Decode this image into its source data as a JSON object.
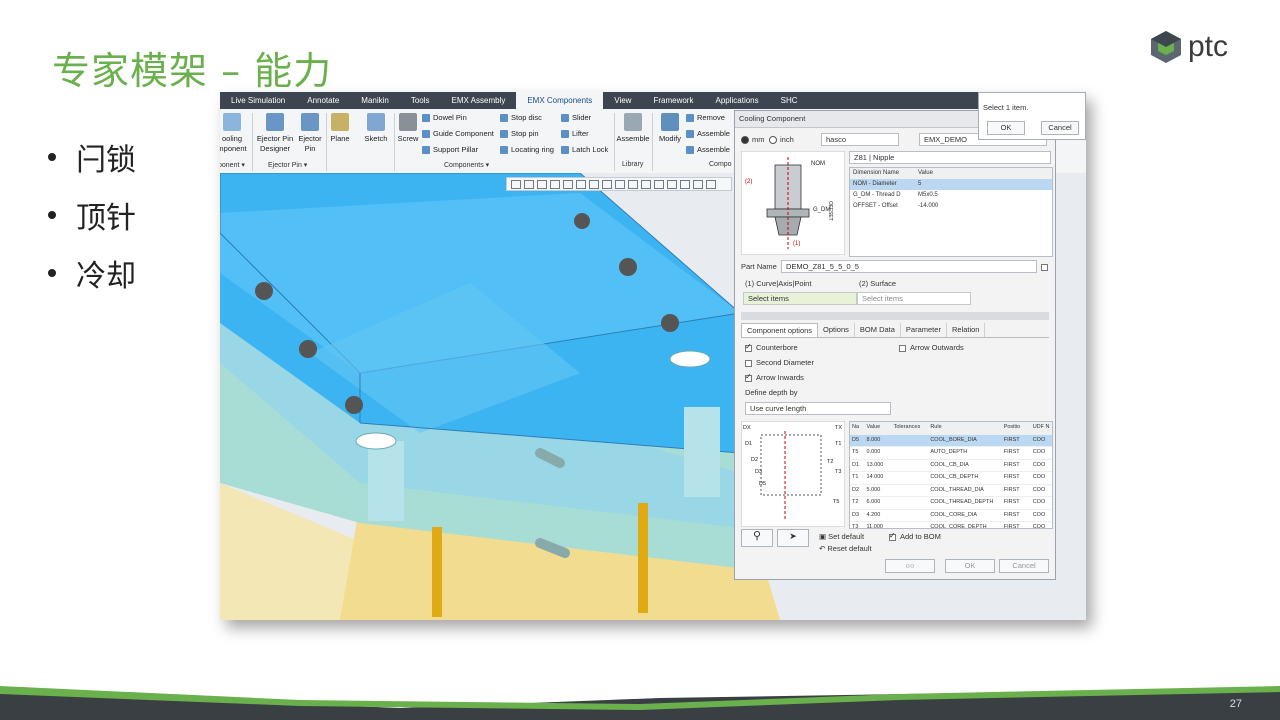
{
  "slide": {
    "title": "专家模架 – 能力",
    "bullets": [
      "闩锁",
      "顶针",
      "冷却"
    ],
    "page_number": "27",
    "logo_text": "ptc",
    "accent_color": "#6ab04c"
  },
  "app": {
    "tabs": [
      "Live Simulation",
      "Annotate",
      "Manikin",
      "Tools",
      "EMX Assembly",
      "EMX Components",
      "View",
      "Framework",
      "Applications",
      "SHC"
    ],
    "active_tab": "EMX Components",
    "ribbon": {
      "cooling_label_1": "ooling",
      "cooling_label_2": "mponent",
      "component_group_left": "ponent ▾",
      "ejector_pin_designer_1": "Ejector Pin",
      "ejector_pin_designer_2": "Designer",
      "ejector_pin_1": "Ejector",
      "ejector_pin_2": "Pin",
      "ejector_pin_group": "Ejector Pin ▾",
      "plane": "Plane",
      "sketch": "Sketch",
      "screw": "Screw",
      "dowel_pin": "Dowel Pin",
      "guide_component": "Guide Component",
      "support_pillar": "Support Pillar",
      "stop_disc": "Stop disc",
      "stop_pin": "Stop pin",
      "locating_ring": "Locating ring",
      "slider": "Slider",
      "lifter": "Lifter",
      "latch_lock": "Latch Lock",
      "components_group": "Components ▾",
      "assemble": "Assemble",
      "library_group": "Library",
      "modify": "Modify",
      "remove": "Remove",
      "assemble_2": "Assemble",
      "assemble_3": "Assemble",
      "compo_group": "Compo"
    },
    "popup": {
      "message": "Select 1 item.",
      "ok": "OK",
      "cancel": "Cancel"
    },
    "dialog": {
      "title": "Cooling Component",
      "unit_mm": "mm",
      "unit_inch": "inch",
      "unit_selected": "mm",
      "supplier": "hasco",
      "catalog": "EMX_DEMO",
      "component_type": "Z81 | Nipple",
      "dim_table": {
        "headers": [
          "Dimension Name",
          "Value"
        ],
        "rows": [
          [
            "NOM - Diameter",
            "5"
          ],
          [
            "G_DM - Thread D",
            "M5x0.5"
          ],
          [
            "OFFSET - Offset",
            "-14.000"
          ]
        ]
      },
      "diagram_labels": {
        "nom": "NOM",
        "offset": "OFFSET",
        "g_dm": "G_DM",
        "l1": "(1)",
        "l2": "(2)"
      },
      "part_name_label": "Part Name",
      "part_name": "DEMO_Z81_5_5_0_5",
      "ref1_label": "(1) Curve|Axis|Point",
      "ref2_label": "(2) Surface",
      "ref1_value": "Select items",
      "ref2_value": "Select items",
      "tabs": [
        "Component options",
        "Options",
        "BOM Data",
        "Parameter",
        "Relation"
      ],
      "active_tab": "Component options",
      "opt_counterbore": "Counterbore",
      "opt_second_diameter": "Second Diameter",
      "opt_arrow_inwards": "Arrow Inwards",
      "opt_arrow_outwards": "Arrow Outwards",
      "define_depth_label": "Define depth by",
      "depth_mode": "Use curve length",
      "diagram2_labels": [
        "DX",
        "TX",
        "D1",
        "T1",
        "D2",
        "T2",
        "D3",
        "T3",
        "D5",
        "T5"
      ],
      "grid": {
        "headers": [
          "Na",
          "Value",
          "Tolerances",
          "Rule",
          "Positio",
          "UDF N"
        ],
        "rows": [
          [
            "D5",
            "8.000",
            "",
            "COOL_BORE_DIA",
            "FIRST",
            "COO"
          ],
          [
            "T5",
            "0.000",
            "",
            "AUTO_DEPTH",
            "FIRST",
            "COO"
          ],
          [
            "D1",
            "13.000",
            "",
            "COOL_CB_DIA",
            "FIRST",
            "COO"
          ],
          [
            "T1",
            "14.000",
            "",
            "COOL_CB_DEPTH",
            "FIRST",
            "COO"
          ],
          [
            "D2",
            "5.000",
            "",
            "COOL_THREAD_DIA",
            "FIRST",
            "COO"
          ],
          [
            "T2",
            "6.000",
            "",
            "COOL_THREAD_DEPTH",
            "FIRST",
            "COO"
          ],
          [
            "D3",
            "4.200",
            "",
            "COOL_CORE_DIA",
            "FIRST",
            "COO"
          ],
          [
            "T3",
            "11.000",
            "",
            "COOL_CORE_DEPTH",
            "FIRST",
            "COO"
          ]
        ]
      },
      "set_default": "Set default",
      "reset_default": "Reset default",
      "add_to_bom": "Add to BOM",
      "ok": "OK",
      "cancel": "Cancel"
    }
  }
}
